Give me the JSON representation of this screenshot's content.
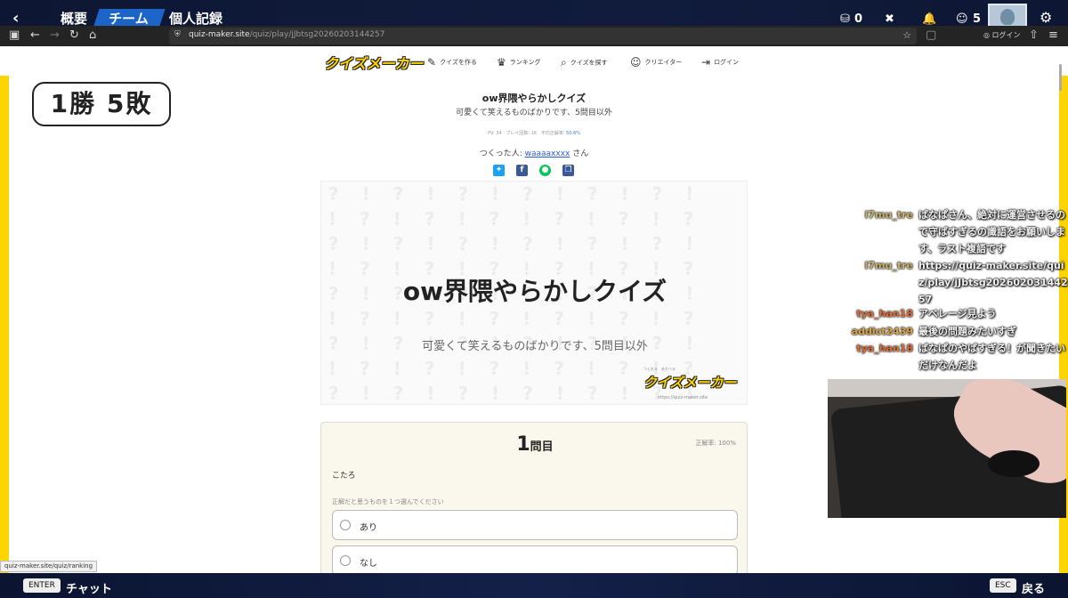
{
  "game": {
    "tabs": [
      "概要",
      "チーム",
      "個人記録"
    ],
    "active_tab": "チーム",
    "stats": {
      "currency": "0",
      "friends": "5"
    }
  },
  "browser": {
    "url_domain": "quiz-maker.site",
    "url_path": "/quiz/play/jJbtsg20260203144257",
    "login_label": "ログイン"
  },
  "site": {
    "logo": "クイズメーカー",
    "nav": [
      {
        "label": "クイズを作る",
        "icon": "pencil-icon"
      },
      {
        "label": "ランキング",
        "icon": "crown-icon"
      },
      {
        "label": "クイズを探す",
        "icon": "search-icon"
      },
      {
        "label": "クリエイター",
        "icon": "user-icon"
      },
      {
        "label": "ログイン",
        "icon": "login-icon"
      }
    ]
  },
  "overlay": {
    "record": "1勝 5敗"
  },
  "quiz": {
    "title": "ow界隈やらかしクイズ",
    "subtitle": "可愛くて笑えるものばかりです、5問目以外",
    "stats": {
      "pv": "PV: 34",
      "plays": "プレイ回数: 16",
      "avg_label": "平均正解率:",
      "avg_value": "50.6%"
    },
    "author_prefix": "つくった人:",
    "author": "waaaaxxxx",
    "author_suffix": "さん",
    "hero_logo": "クイズメーカー",
    "hero_logo_tag": "つくれる　あそべる",
    "hero_logo_url": "https://quiz-maker.site"
  },
  "question": {
    "number": "1",
    "number_suffix": "問目",
    "rate": "正解率: 100%",
    "text": "こたろ",
    "instruction": "正解だと思うものを１つ選んでください",
    "options": [
      "あり",
      "なし"
    ]
  },
  "chat": [
    {
      "user": "l7mu_tre",
      "color": "#c8b26a",
      "text": "ばなぱさん、絶対に運営させるので守ばすぎるの識語をお願いします、ラスト複語です"
    },
    {
      "user": "l7mu_tre",
      "color": "#c8b26a",
      "text": "https://quiz-maker.site/quiz/play/jJbtsg20260203144257"
    },
    {
      "user": "tya_han18",
      "color": "#e0703a",
      "text": "アベレージ見よう"
    },
    {
      "user": "addict2439",
      "color": "#d9a441",
      "text": "最後の問題みたいすぎ"
    },
    {
      "user": "tya_han18",
      "color": "#e0703a",
      "text": "ばなぱのやばすぎる！が聞きたいだけなんだよ"
    }
  ],
  "status_tip": "quiz-maker.site/quiz/ranking",
  "bottom": {
    "enter_key": "ENTER",
    "enter_label": "チャット",
    "esc_key": "ESC",
    "esc_label": "戻る"
  }
}
